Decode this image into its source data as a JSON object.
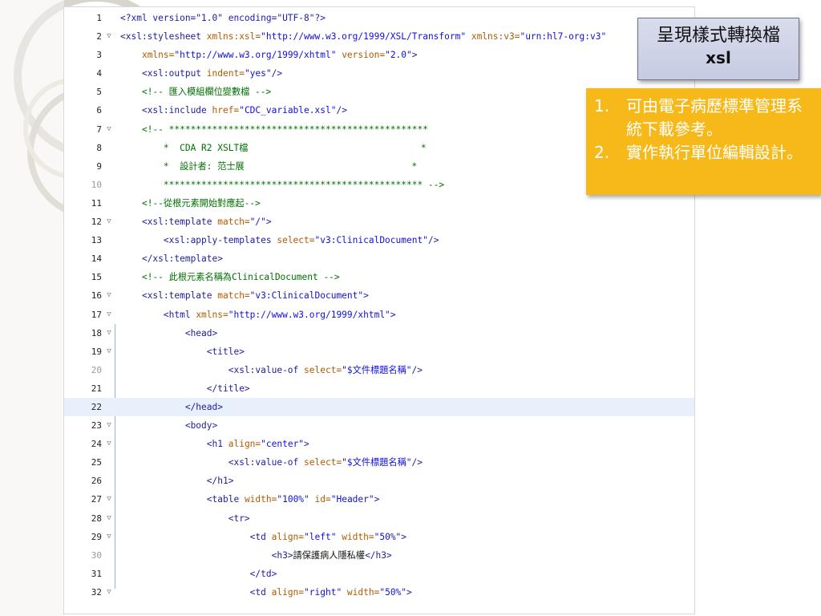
{
  "colors": {
    "tag": "#2020a0",
    "attribute": "#b15a00",
    "value": "#1010d8",
    "comment": "#006f00",
    "highlight_line": "#e8f0fb",
    "title_callout_bg": "#cfd4e8",
    "notes_callout_bg": "#f7b91a"
  },
  "editor": {
    "lines": [
      {
        "num": "1",
        "fold": false
      },
      {
        "num": "2",
        "fold": true
      },
      {
        "num": "3",
        "fold": false
      },
      {
        "num": "4",
        "fold": false
      },
      {
        "num": "5",
        "fold": false
      },
      {
        "num": "6",
        "fold": false
      },
      {
        "num": "7",
        "fold": true
      },
      {
        "num": "8",
        "fold": false
      },
      {
        "num": "9",
        "fold": false
      },
      {
        "num": "10",
        "fold": false
      },
      {
        "num": "11",
        "fold": false
      },
      {
        "num": "12",
        "fold": true
      },
      {
        "num": "13",
        "fold": false
      },
      {
        "num": "14",
        "fold": false
      },
      {
        "num": "15",
        "fold": false
      },
      {
        "num": "16",
        "fold": true
      },
      {
        "num": "17",
        "fold": true
      },
      {
        "num": "18",
        "fold": true
      },
      {
        "num": "19",
        "fold": true
      },
      {
        "num": "20",
        "fold": false
      },
      {
        "num": "21",
        "fold": false
      },
      {
        "num": "22",
        "fold": false
      },
      {
        "num": "23",
        "fold": true
      },
      {
        "num": "24",
        "fold": true
      },
      {
        "num": "25",
        "fold": false
      },
      {
        "num": "26",
        "fold": false
      },
      {
        "num": "27",
        "fold": true
      },
      {
        "num": "28",
        "fold": true
      },
      {
        "num": "29",
        "fold": true
      },
      {
        "num": "30",
        "fold": false
      },
      {
        "num": "31",
        "fold": false
      },
      {
        "num": "32",
        "fold": true
      }
    ],
    "code": {
      "l1": "<?xml version=\"1.0\" encoding=\"UTF-8\"?>",
      "l2_tag": "<xsl:stylesheet",
      "l2_a1": " xmlns:xsl=",
      "l2_v1": "\"http://www.w3.org/1999/XSL/Transform\"",
      "l2_a2": " xmlns:v3=",
      "l2_v2": "\"urn:hl7-org:v3\"",
      "l3_a": "xmlns=",
      "l3_v": "\"http://www.w3.org/1999/xhtml\"",
      "l3_a2": " version=",
      "l3_v2": "\"2.0\"",
      "l3_end": ">",
      "l4_tag": "<xsl:output",
      "l4_a": " indent=",
      "l4_v": "\"yes\"",
      "l4_end": "/>",
      "l5": "<!-- 匯入模組欄位變數檔 -->",
      "l6_tag": "<xsl:include",
      "l6_a": " href=",
      "l6_v": "\"CDC_variable.xsl\"",
      "l6_end": "/>",
      "l7": "<!-- ************************************************",
      "l8": "    *  CDA R2 XSLT檔                                *",
      "l9": "    *  設計者: 范士展                               *",
      "l10": "    ************************************************ -->",
      "l11": "<!--從根元素開始對應起-->",
      "l12_tag": "<xsl:template",
      "l12_a": " match=",
      "l12_v": "\"/\"",
      "l12_end": ">",
      "l13_tag": "    <xsl:apply-templates",
      "l13_a": " select=",
      "l13_v": "\"v3:ClinicalDocument\"",
      "l13_end": "/>",
      "l14": "</xsl:template>",
      "l15": "<!-- 此根元素名稱為ClinicalDocument -->",
      "l16_tag": "<xsl:template",
      "l16_a": " match=",
      "l16_v": "\"v3:ClinicalDocument\"",
      "l16_end": ">",
      "l17_tag": "    <html",
      "l17_a": " xmlns=",
      "l17_v": "\"http://www.w3.org/1999/xhtml\"",
      "l17_end": ">",
      "l18": "        <head>",
      "l19": "            <title>",
      "l20_tag": "                <xsl:value-of",
      "l20_a": " select=",
      "l20_v": "\"$文件標題名稱\"",
      "l20_end": "/>",
      "l21": "            </title>",
      "l22": "        </head>",
      "l23": "        <body>",
      "l24_tag": "            <h1",
      "l24_a": " align=",
      "l24_v": "\"center\"",
      "l24_end": ">",
      "l25_tag": "                <xsl:value-of",
      "l25_a": " select=",
      "l25_v": "\"$文件標題名稱\"",
      "l25_end": "/>",
      "l26": "            </h1>",
      "l27_tag": "            <table",
      "l27_a1": " width=",
      "l27_v1": "\"100%\"",
      "l27_a2": " id=",
      "l27_v2": "\"Header\"",
      "l27_end": ">",
      "l28": "                <tr>",
      "l29_tag": "                    <td",
      "l29_a1": " align=",
      "l29_v1": "\"left\"",
      "l29_a2": " width=",
      "l29_v2": "\"50%\"",
      "l29_end": ">",
      "l30_tag": "                        <h3>",
      "l30_text": "請保護病人隱私權",
      "l30_end": "</h3>",
      "l31": "                    </td>",
      "l32_tag": "                    <td",
      "l32_a1": " align=",
      "l32_v1": "\"right\"",
      "l32_a2": " width=",
      "l32_v2": "\"50%\"",
      "l32_end": ">"
    }
  },
  "callout_title": {
    "line1": "呈現樣式轉換檔",
    "line2": "xsl"
  },
  "callout_notes": {
    "items": [
      {
        "num": "1.",
        "text": "可由電子病歷標準管理系統下載參考。"
      },
      {
        "num": "2.",
        "text": "實作執行單位編輯設計。"
      }
    ]
  }
}
